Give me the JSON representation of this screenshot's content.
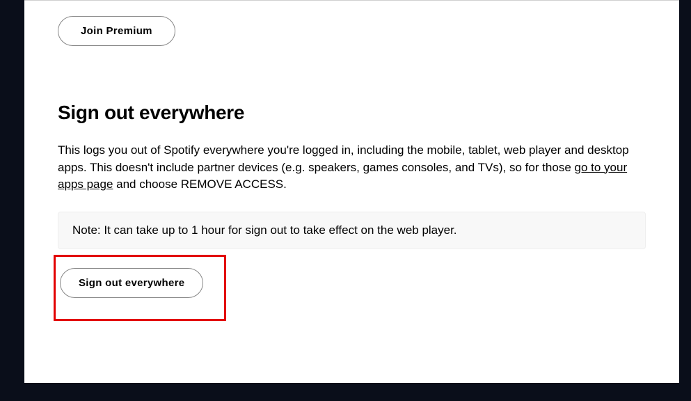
{
  "premium": {
    "button_label": "Join Premium"
  },
  "signout": {
    "heading": "Sign out everywhere",
    "description_part1": "This logs you out of Spotify everywhere you're logged in, including the mobile, tablet, web player and desktop apps. This doesn't include partner devices (e.g. speakers, games consoles, and TVs), so for those ",
    "link_text": "go to your apps page",
    "description_part2": " and choose REMOVE ACCESS.",
    "note": "Note: It can take up to 1 hour for sign out to take effect on the web player.",
    "button_label": "Sign out everywhere"
  }
}
